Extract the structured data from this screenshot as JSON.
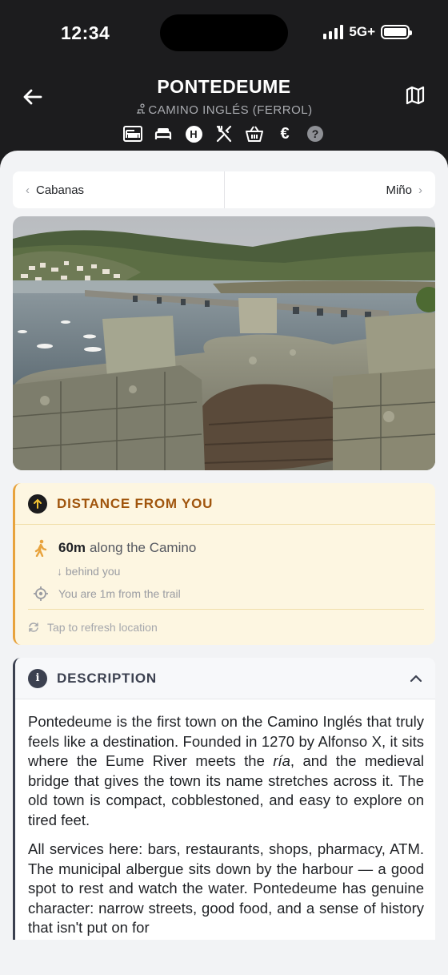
{
  "status_bar": {
    "time": "12:34",
    "network": "5G+"
  },
  "header": {
    "title": "PONTEDEUME",
    "subtitle": "CAMINO INGLÉS (FERROL)",
    "services": [
      {
        "icon": "albergue-icon"
      },
      {
        "icon": "bed-icon"
      },
      {
        "icon": "hotel-icon",
        "label": "H"
      },
      {
        "icon": "restaurant-icon"
      },
      {
        "icon": "shop-basket-icon"
      },
      {
        "icon": "euro-icon",
        "label": "€"
      },
      {
        "icon": "help-icon",
        "label": "?"
      }
    ]
  },
  "nav": {
    "prev": "Cabanas",
    "next": "Miño"
  },
  "distance": {
    "title": "DISTANCE FROM YOU",
    "distance_value": "60m",
    "along": "along the Camino",
    "behind": "behind you",
    "trail": "You are 1m from the trail",
    "refresh": "Tap to refresh location"
  },
  "description": {
    "title": "DESCRIPTION",
    "p1_a": "Pontedeume is the first town on the Camino Inglés that truly feels like a destination. Founded in 1270 by Alfonso X, it sits where the Eume River meets the ",
    "p1_em": "ría",
    "p1_b": ", and the medieval bridge that gives the town its name stretches across it. The old town is compact, cobblestoned, and easy to explore on tired feet.",
    "p2": "All services here: bars, restaurants, shops, pharmacy, ATM. The municipal albergue sits down by the harbour — a good spot to rest and watch the water. Pontedeume has genuine character: narrow streets, good food, and a sense of history that isn't put on for"
  },
  "colors": {
    "accent_orange": "#e8a33d",
    "distance_title": "#a0550d",
    "dark_header": "#1c1c1e",
    "description_accent": "#3c4150"
  }
}
